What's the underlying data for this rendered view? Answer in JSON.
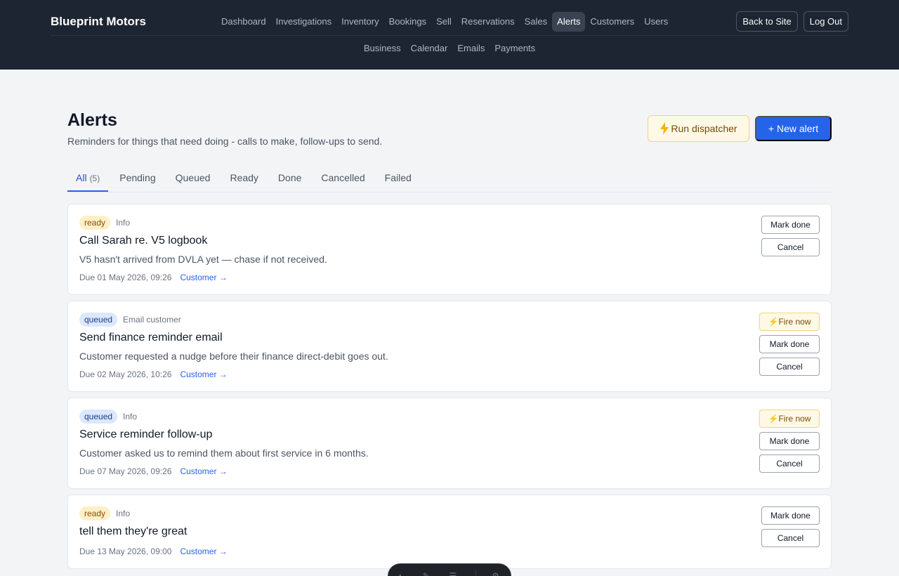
{
  "brand": "Blueprint Motors",
  "nav": {
    "row1": [
      "Dashboard",
      "Investigations",
      "Inventory",
      "Bookings",
      "Sell",
      "Reservations",
      "Sales",
      "Alerts",
      "Customers",
      "Users"
    ],
    "row2": [
      "Business",
      "Calendar",
      "Emails",
      "Payments"
    ],
    "active": "Alerts"
  },
  "top_actions": {
    "back": "Back to Site",
    "logout": "Log Out"
  },
  "page": {
    "title": "Alerts",
    "subtitle": "Reminders for things that need doing - calls to make, follow-ups to send.",
    "dispatch_label": "Run dispatcher",
    "new_label": "+ New alert"
  },
  "tabs": [
    {
      "label": "All",
      "count": "(5)"
    },
    {
      "label": "Pending"
    },
    {
      "label": "Queued"
    },
    {
      "label": "Ready"
    },
    {
      "label": "Done"
    },
    {
      "label": "Cancelled"
    },
    {
      "label": "Failed"
    }
  ],
  "alerts": [
    {
      "status": "ready",
      "type": "Info",
      "title": "Call Sarah re. V5 logbook",
      "desc": "V5 hasn't arrived from DVLA yet — chase if not received.",
      "due": "Due 01 May 2026, 09:26",
      "link": "Customer →",
      "actions": [
        "Mark done",
        "Cancel"
      ]
    },
    {
      "status": "queued",
      "type": "Email customer",
      "title": "Send finance reminder email",
      "desc": "Customer requested a nudge before their finance direct-debit goes out.",
      "due": "Due 02 May 2026, 10:26",
      "link": "Customer →",
      "actions": [
        "Fire now",
        "Mark done",
        "Cancel"
      ]
    },
    {
      "status": "queued",
      "type": "Info",
      "title": "Service reminder follow-up",
      "desc": "Customer asked us to remind them about first service in 6 months.",
      "due": "Due 07 May 2026, 09:26",
      "link": "Customer →",
      "actions": [
        "Fire now",
        "Mark done",
        "Cancel"
      ]
    },
    {
      "status": "ready",
      "type": "Info",
      "title": "tell them they're great",
      "desc": "",
      "due": "Due 13 May 2026, 09:00",
      "link": "Customer →",
      "actions": [
        "Mark done",
        "Cancel"
      ]
    }
  ],
  "icons": {
    "dispatch": "lightning-icon",
    "fire": "lightning-icon"
  },
  "colors": {
    "header_bg": "#1e2532",
    "primary": "#2563eb",
    "ready_badge": "#fdf0c7",
    "queued_badge": "#dbe8fd"
  }
}
